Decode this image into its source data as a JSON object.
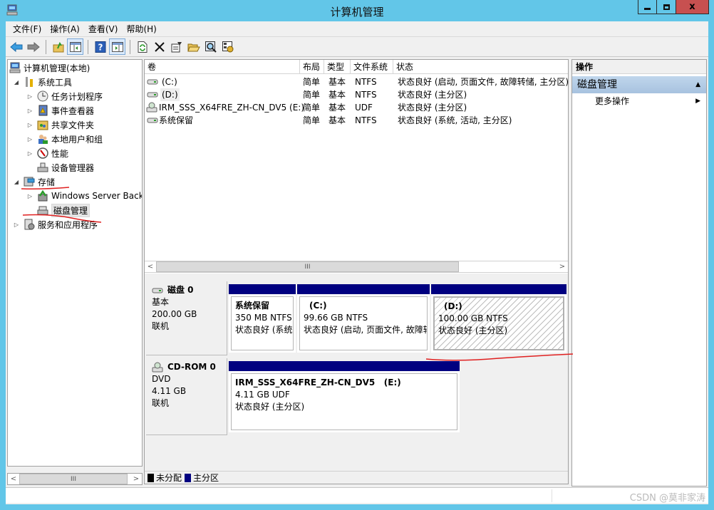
{
  "window": {
    "title": "计算机管理",
    "icon": "computer-management-icon",
    "controls": {
      "minimize": "minimize",
      "maximize": "maximize",
      "close": "x"
    }
  },
  "menu": [
    "文件(F)",
    "操作(A)",
    "查看(V)",
    "帮助(H)"
  ],
  "toolbar": [
    "back-arrow-icon",
    "forward-arrow-icon",
    "up-folder-icon",
    "show-hide-tree-icon",
    "help-icon",
    "show-hide-action-pane-icon",
    "refresh-icon",
    "delete-icon",
    "properties-icon",
    "open-folder-icon",
    "search-icon",
    "settings-icon"
  ],
  "tree": {
    "items": [
      {
        "label": "计算机管理(本地)",
        "icon": "computer-icon",
        "toggle": ""
      },
      {
        "label": "系统工具",
        "icon": "tools-icon",
        "toggle": "◢"
      },
      {
        "label": "任务计划程序",
        "icon": "clock-icon",
        "toggle": "▷"
      },
      {
        "label": "事件查看器",
        "icon": "event-log-icon",
        "toggle": "▷"
      },
      {
        "label": "共享文件夹",
        "icon": "shared-folder-icon",
        "toggle": "▷"
      },
      {
        "label": "本地用户和组",
        "icon": "users-icon",
        "toggle": "▷"
      },
      {
        "label": "性能",
        "icon": "performance-icon",
        "toggle": "▷"
      },
      {
        "label": "设备管理器",
        "icon": "device-manager-icon",
        "toggle": ""
      },
      {
        "label": "存储",
        "icon": "storage-icon",
        "toggle": "◢"
      },
      {
        "label": "Windows Server Back",
        "icon": "backup-icon",
        "toggle": "▷"
      },
      {
        "label": "磁盘管理",
        "icon": "disk-management-icon",
        "toggle": ""
      },
      {
        "label": "服务和应用程序",
        "icon": "services-icon",
        "toggle": "▷"
      }
    ],
    "scroll_thumb": "III"
  },
  "volumes": {
    "columns": [
      "卷",
      "布局",
      "类型",
      "文件系统",
      "状态"
    ],
    "rows": [
      {
        "volume": "(C:)",
        "layout": "简单",
        "type": "基本",
        "fs": "NTFS",
        "status": "状态良好 (启动, 页面文件, 故障转储, 主分区)"
      },
      {
        "volume": "(D:)",
        "layout": "简单",
        "type": "基本",
        "fs": "NTFS",
        "status": "状态良好 (主分区)"
      },
      {
        "volume": "IRM_SSS_X64FRE_ZH-CN_DV5 (E:)",
        "layout": "简单",
        "type": "基本",
        "fs": "UDF",
        "status": "状态良好 (主分区)"
      },
      {
        "volume": "系统保留",
        "layout": "简单",
        "type": "基本",
        "fs": "NTFS",
        "status": "状态良好 (系统, 活动, 主分区)"
      }
    ],
    "scroll_thumb": "III"
  },
  "disks": [
    {
      "name": "磁盘 0",
      "kind": "基本",
      "size": "200.00 GB",
      "state": "联机",
      "partitions": [
        {
          "name": "系统保留",
          "size": "350 MB NTFS",
          "status": "状态良好 (系统"
        },
        {
          "name": "(C:)",
          "size": "99.66 GB NTFS",
          "status": "状态良好 (启动, 页面文件, 故障转"
        },
        {
          "name": "(D:)",
          "size": "100.00 GB NTFS",
          "status": "状态良好 (主分区)"
        }
      ]
    },
    {
      "name": "CD-ROM 0",
      "kind": "DVD",
      "size": "4.11 GB",
      "state": "联机",
      "partitions": [
        {
          "name": "IRM_SSS_X64FRE_ZH-CN_DV5   (E:)",
          "size": "4.11 GB UDF",
          "status": "状态良好 (主分区)"
        }
      ]
    }
  ],
  "legend": [
    {
      "label": "未分配",
      "color": "#000000"
    },
    {
      "label": "主分区",
      "color": "#000080"
    }
  ],
  "actions": {
    "header": "操作",
    "group": "磁盘管理",
    "items": [
      "更多操作"
    ]
  },
  "statusbar": {
    "watermark": "CSDN @莫非家涛"
  },
  "colors": {
    "titlebar": "#62c6e8",
    "partition_header": "#000080",
    "close_button": "#c75050",
    "annotation": "#e02020"
  }
}
